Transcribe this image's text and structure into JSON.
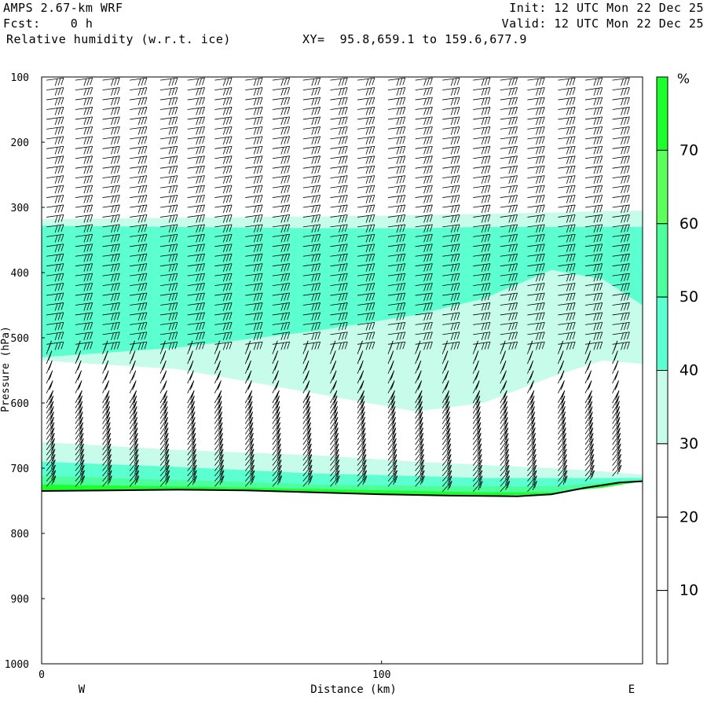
{
  "header": {
    "model": "AMPS 2.67-km WRF",
    "fcst": "Fcst:    0 h",
    "field": "Relative humidity (w.r.t. ice)",
    "xy": "XY=  95.8,659.1 to 159.6,677.9",
    "init": "Init: 12 UTC Mon 22 Dec 25",
    "valid": "Valid: 12 UTC Mon 22 Dec 25"
  },
  "chart_data": {
    "type": "heatmap",
    "title": "Relative humidity (w.r.t. ice)",
    "xlabel": "Distance (km)",
    "ylabel": "Pressure (hPa)",
    "xlim": [
      0,
      176.8
    ],
    "ylim": [
      1000,
      100
    ],
    "xticks": [
      {
        "v": 0,
        "label": "0"
      },
      {
        "v": 100,
        "label": "100"
      }
    ],
    "yticks": [
      100,
      200,
      300,
      400,
      500,
      600,
      700,
      800,
      900,
      1000
    ],
    "x_end_labels": {
      "left": "W",
      "right": "E"
    },
    "colorbar": {
      "unit": "%",
      "levels": [
        10,
        20,
        30,
        40,
        50,
        60,
        70
      ],
      "colors": [
        "#ffffff",
        "#ffffff",
        "#ffffff",
        "#c8fcea",
        "#5cffd0",
        "#4cff9c",
        "#5cff5c",
        "#1cff2c"
      ]
    },
    "terrain_surface_hPa": {
      "x": [
        0,
        20,
        40,
        60,
        80,
        100,
        120,
        140,
        150,
        160,
        170,
        176.8
      ],
      "p": [
        735,
        734,
        733,
        734,
        737,
        740,
        742,
        743,
        740,
        730,
        722,
        720
      ]
    },
    "regions": [
      {
        "level": 30,
        "x": [
          0,
          40,
          80,
          110,
          130,
          150,
          165,
          176.8
        ],
        "top": [
          318,
          316,
          314,
          312,
          310,
          308,
          306,
          305
        ],
        "bottom": [
          535,
          548,
          585,
          613,
          600,
          560,
          535,
          540
        ]
      },
      {
        "level": 40,
        "x": [
          0,
          40,
          80,
          110,
          130,
          150,
          165,
          176.8
        ],
        "top": [
          328,
          330,
          332,
          332,
          330,
          330,
          330,
          330
        ],
        "bottom": [
          530,
          515,
          490,
          465,
          440,
          396,
          410,
          450
        ]
      },
      {
        "level": 30,
        "x": [
          0,
          40,
          80,
          110,
          130,
          150,
          165,
          176.8
        ],
        "top": [
          660,
          672,
          680,
          690,
          695,
          700,
          705,
          710
        ],
        "bottom": "surface"
      },
      {
        "level": 40,
        "x": [
          0,
          40,
          80,
          110,
          130,
          150,
          165,
          176.8
        ],
        "top": [
          690,
          698,
          708,
          712,
          715,
          715,
          715,
          715
        ],
        "bottom": "surface"
      },
      {
        "level": 50,
        "x": [
          0,
          40,
          80,
          110,
          130,
          150,
          165,
          176.8
        ],
        "top": [
          712,
          718,
          725,
          727,
          728,
          728,
          722,
          718
        ],
        "bottom": "surface"
      },
      {
        "level": 70,
        "x": [
          0,
          40,
          80,
          110,
          130,
          150,
          165,
          176.8
        ],
        "top": [
          725,
          728,
          732,
          735,
          737,
          737,
          730,
          720
        ],
        "bottom": "surface"
      }
    ],
    "wind_barbs": {
      "columns_km": [
        0.5,
        9,
        17,
        25,
        34,
        42,
        50,
        59,
        67,
        76,
        84,
        92,
        101,
        109,
        117,
        126,
        134,
        142,
        151,
        159,
        167
      ],
      "direction": "westerly",
      "upper_speed_kt": 30,
      "lower_speed_kt": 25
    }
  }
}
